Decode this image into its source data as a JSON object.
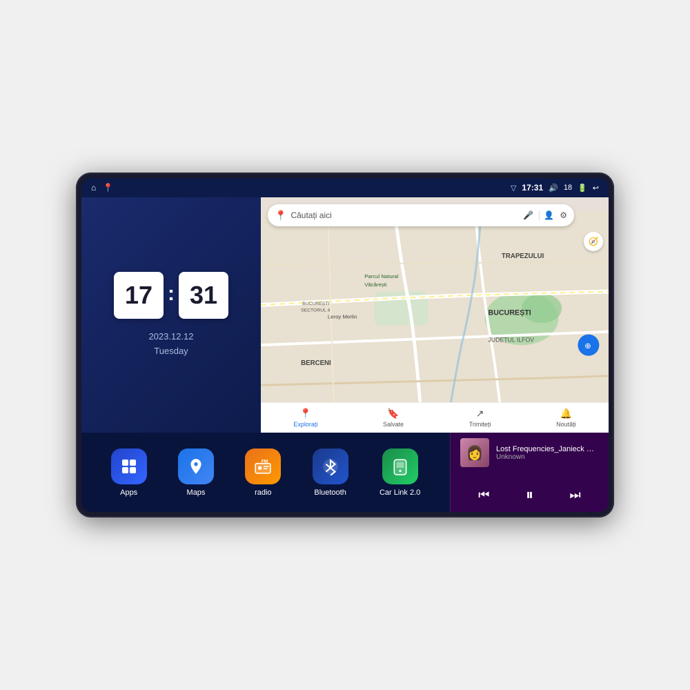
{
  "device": {
    "status_bar": {
      "time": "17:31",
      "battery": "18",
      "signal_icon": "▽",
      "volume_icon": "🔊",
      "battery_icon": "🔋",
      "back_icon": "↩"
    },
    "nav_icons": {
      "home": "⌂",
      "maps_shortcut": "📍"
    },
    "clock": {
      "hour": "17",
      "minute": "31",
      "date": "2023.12.12",
      "day": "Tuesday"
    },
    "map": {
      "search_placeholder": "Căutați aici",
      "nav_items": [
        {
          "label": "Explorați",
          "icon": "📍",
          "active": true
        },
        {
          "label": "Salvate",
          "icon": "🔖",
          "active": false
        },
        {
          "label": "Trimiteți",
          "icon": "🔄",
          "active": false
        },
        {
          "label": "Noutăți",
          "icon": "🔔",
          "active": false
        }
      ],
      "location_names": [
        "TRAPEZULUI",
        "BUCUREȘTI",
        "JUDEȚUL ILFOV",
        "BERCENI",
        "Parcul Natural Văcărești",
        "Leroy Merlin",
        "BUCUREȘTI SECTORUL 4"
      ]
    },
    "apps": [
      {
        "id": "apps",
        "label": "Apps",
        "icon": "⊞",
        "color_class": "icon-apps"
      },
      {
        "id": "maps",
        "label": "Maps",
        "icon": "🗺",
        "color_class": "icon-maps"
      },
      {
        "id": "radio",
        "label": "radio",
        "icon": "📻",
        "color_class": "icon-radio"
      },
      {
        "id": "bluetooth",
        "label": "Bluetooth",
        "icon": "⚡",
        "color_class": "icon-bluetooth"
      },
      {
        "id": "carlink",
        "label": "Car Link 2.0",
        "icon": "📱",
        "color_class": "icon-carlink"
      }
    ],
    "music": {
      "title": "Lost Frequencies_Janieck Devy-...",
      "artist": "Unknown",
      "thumb_emoji": "🎵"
    }
  }
}
